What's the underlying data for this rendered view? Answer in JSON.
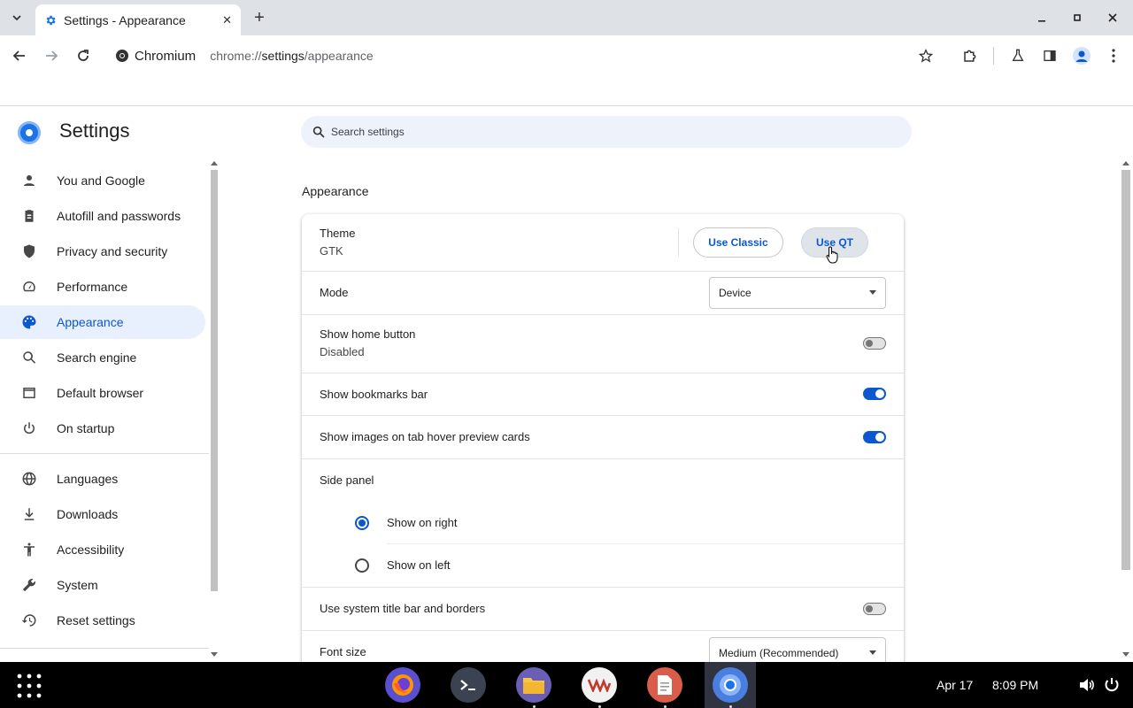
{
  "browser": {
    "tab_title": "Settings - Appearance",
    "origin_label": "Chromium",
    "url_prefix": "chrome://",
    "url_host": "settings",
    "url_path": "/appearance"
  },
  "settings": {
    "title": "Settings",
    "search_placeholder": "Search settings"
  },
  "sidebar": {
    "items": [
      {
        "label": "You and Google",
        "icon": "person-icon"
      },
      {
        "label": "Autofill and passwords",
        "icon": "clipboard-icon"
      },
      {
        "label": "Privacy and security",
        "icon": "shield-icon"
      },
      {
        "label": "Performance",
        "icon": "speedometer-icon"
      },
      {
        "label": "Appearance",
        "icon": "palette-icon",
        "active": true
      },
      {
        "label": "Search engine",
        "icon": "search-icon"
      },
      {
        "label": "Default browser",
        "icon": "browser-window-icon"
      },
      {
        "label": "On startup",
        "icon": "power-icon"
      },
      {
        "label": "Languages",
        "icon": "globe-icon"
      },
      {
        "label": "Downloads",
        "icon": "download-icon"
      },
      {
        "label": "Accessibility",
        "icon": "accessibility-icon"
      },
      {
        "label": "System",
        "icon": "wrench-icon"
      },
      {
        "label": "Reset settings",
        "icon": "history-icon"
      }
    ]
  },
  "appearance": {
    "section_title": "Appearance",
    "theme_label": "Theme",
    "theme_value": "GTK",
    "use_classic": "Use Classic",
    "use_qt": "Use QT",
    "mode_label": "Mode",
    "mode_value": "Device",
    "home_button_label": "Show home button",
    "home_button_sub": "Disabled",
    "home_button_on": false,
    "bookmarks_bar_label": "Show bookmarks bar",
    "bookmarks_bar_on": true,
    "tab_hover_label": "Show images on tab hover preview cards",
    "tab_hover_on": true,
    "side_panel_label": "Side panel",
    "side_panel_right": "Show on right",
    "side_panel_left": "Show on left",
    "side_panel_selected": "right",
    "title_bar_label": "Use system title bar and borders",
    "title_bar_on": false,
    "font_size_label": "Font size",
    "font_size_value": "Medium (Recommended)"
  },
  "taskbar": {
    "apps": [
      "firefox-icon",
      "terminal-icon",
      "files-icon",
      "vm-icon",
      "text-editor-icon",
      "chromium-icon"
    ],
    "date": "Apr 17",
    "time": "8:09 PM"
  },
  "colors": {
    "accent": "#0b57d0",
    "active_nav_bg": "#e8effd",
    "tabstrip_bg": "#dee1e6"
  }
}
